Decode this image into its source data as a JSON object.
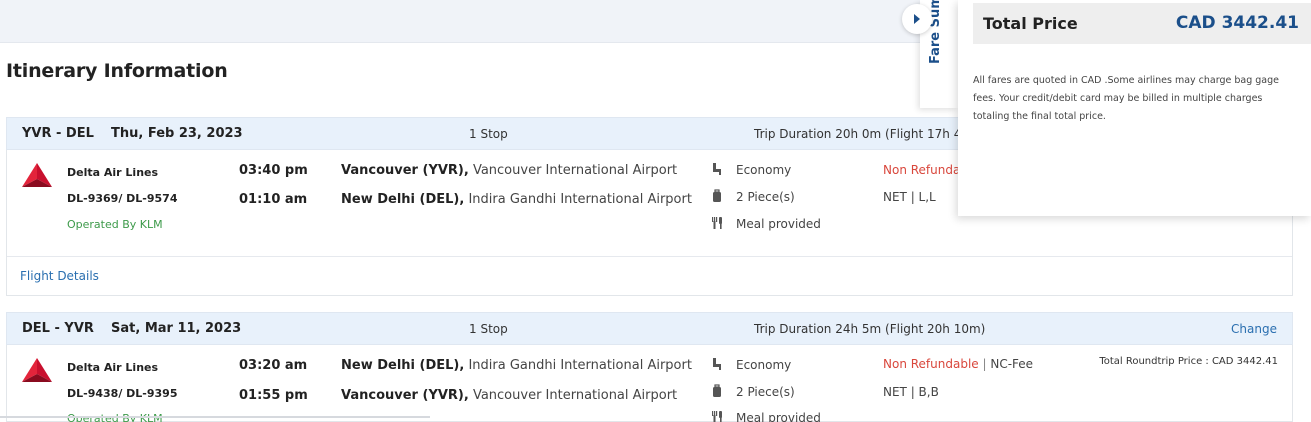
{
  "page": {
    "title": "Itinerary Information"
  },
  "fare_summary": {
    "tab_label": "Fare Sum",
    "total_label": "Total Price",
    "total_value": "CAD 3442.41",
    "note": "All fares are quoted in CAD .Some airlines may charge bag gage fees. Your credit/debit card may be billed in multiple charges totaling the final total price."
  },
  "segments": [
    {
      "route": "YVR - DEL",
      "date": "Thu, Feb 23, 2023",
      "stops": "1 Stop",
      "duration": "Trip Duration 20h 0m (Flight 17h 4",
      "change": "",
      "airline": "Delta Air Lines",
      "flight_numbers": "DL-9369/ DL-9574",
      "operated_by": "Operated By KLM",
      "depart_time": "03:40 pm",
      "arrive_time": "01:10 am",
      "depart_city": "Vancouver (YVR),",
      "depart_airport": " Vancouver International Airport",
      "arrive_city": "New Delhi (DEL),",
      "arrive_airport": " Indira Gandhi International Airport",
      "cabin": "Economy",
      "baggage": "2 Piece(s)",
      "meal": "Meal provided",
      "refund": "Non Refundab",
      "nc_fee": "",
      "fare_basis": "NET | L,L",
      "roundtrip": "",
      "details_link": "Flight Details"
    },
    {
      "route": "DEL - YVR",
      "date": "Sat, Mar 11, 2023",
      "stops": "1 Stop",
      "duration": "Trip Duration 24h 5m (Flight 20h 10m)",
      "change": "Change",
      "airline": "Delta Air Lines",
      "flight_numbers": "DL-9438/ DL-9395",
      "operated_by": "Operated By KLM",
      "depart_time": "03:20 am",
      "arrive_time": "01:55 pm",
      "depart_city": "New Delhi (DEL),",
      "depart_airport": " Indira Gandhi International Airport",
      "arrive_city": "Vancouver (YVR),",
      "arrive_airport": " Vancouver International Airport",
      "cabin": "Economy",
      "baggage": "2 Piece(s)",
      "meal": "Meal provided",
      "refund": "Non Refundable",
      "nc_fee": "NC-Fee",
      "fare_basis": "NET | B,B",
      "roundtrip": "Total Roundtrip Price : CAD 3442.41",
      "details_link": ""
    }
  ],
  "icons": {
    "airline_logo": "delta-logo-icon",
    "cabin": "seat-icon",
    "baggage": "luggage-icon",
    "meal": "cutlery-icon",
    "toggle": "caret-right-icon"
  },
  "colors": {
    "brand_blue": "#1b4f8a",
    "link_blue": "#2a6fb0",
    "refund_red": "#d9473c",
    "operated_green": "#3d9a4a",
    "delta_red": "#c8102e"
  }
}
